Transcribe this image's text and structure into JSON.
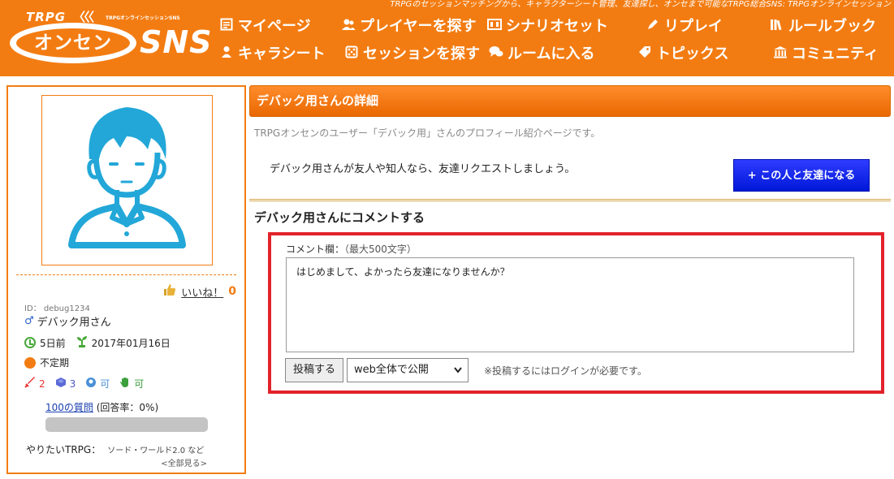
{
  "header": {
    "tagline": "TRPGのセッションマッチングから、キャラクターシート管理、友達探し、オンセまで可能なTRPG総合SNS: TRPGオンラインセッション",
    "logo": {
      "trpg": "TRPG",
      "waves": "〈〈〈",
      "sub": "TRPGオンラインセッションSNS",
      "onsen": "オンセン",
      "sns": "SNS"
    },
    "nav": [
      {
        "label": "マイページ",
        "icon": "id-card-icon"
      },
      {
        "label": "プレイヤーを探す",
        "icon": "users-icon"
      },
      {
        "label": "シナリオセット",
        "icon": "book-icon"
      },
      {
        "label": "リプレイ",
        "icon": "pen-icon"
      },
      {
        "label": "ルールブック",
        "icon": "library-icon"
      },
      {
        "label": "キャラシート",
        "icon": "person-icon"
      },
      {
        "label": "セッションを探す",
        "icon": "dice-icon"
      },
      {
        "label": "ルームに入る",
        "icon": "chat-icon"
      },
      {
        "label": "トピックス",
        "icon": "tag-icon"
      },
      {
        "label": "コミュニティ",
        "icon": "building-icon"
      }
    ]
  },
  "profile": {
    "like_label": "いいね！",
    "like_count": "0",
    "user_id": "ID： debug1234",
    "gender_symbol": "♂",
    "name": "デバック用さん",
    "last_login": "5日前",
    "registered": "2017年01月16日",
    "frequency": "不定期",
    "stats": [
      {
        "value": "2",
        "icon": "sword-icon"
      },
      {
        "value": "3",
        "icon": "dice-icon"
      },
      {
        "value": "可",
        "icon": "voice-icon"
      },
      {
        "value": "可",
        "icon": "hand-icon"
      }
    ],
    "questions_link": "100の質問",
    "questions_rate": "(回答率：0%)",
    "answer_rate": 0,
    "want_label": "やりたいTRPG：",
    "want_games": "ソード・ワールド2.0 など",
    "want_more": "<全部見る>"
  },
  "main": {
    "title": "デバック用さんの詳細",
    "intro": "TRPGオンセンのユーザー「デバック用」さんのプロフィール紹介ページです。",
    "friend_text": "デバック用さんが友人や知人なら、友達リクエストしましょう。",
    "friend_button": "+ この人と友達になる",
    "comment_heading": "デバック用さんにコメントする",
    "comment_label": "コメント欄：",
    "comment_note": "（最大500文字）",
    "comment_value": "はじめまして、よかったら友達になりませんか？",
    "post_button": "投稿する",
    "visibility_selected": "web全体で公開",
    "login_note": "※投稿するにはログインが必要です。"
  },
  "colors": {
    "brand": "#f37c12",
    "friend_button": "#0a1ef0",
    "highlight_border": "#e2222b"
  }
}
